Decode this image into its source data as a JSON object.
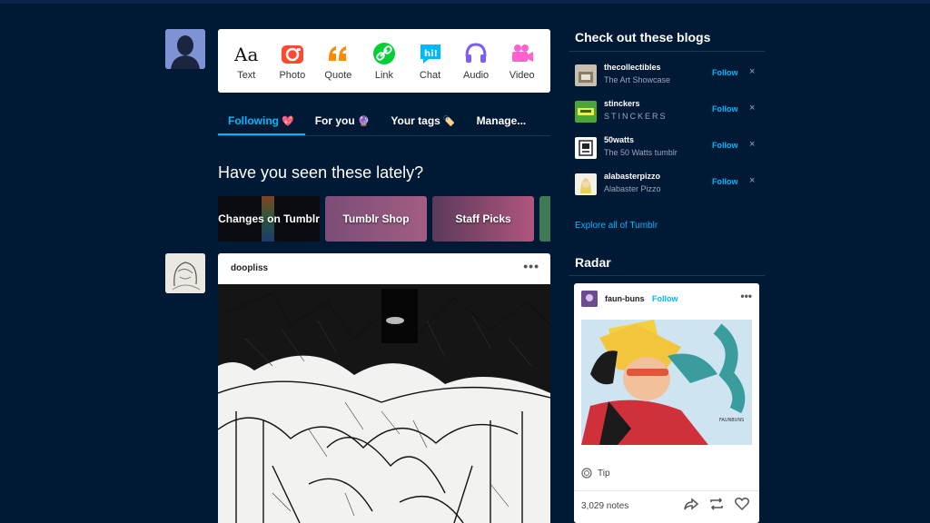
{
  "colors": {
    "background": "#001935",
    "accent": "#00b8ff",
    "card": "#ffffff"
  },
  "compose": {
    "items": [
      {
        "label": "Text",
        "icon": "text-icon"
      },
      {
        "label": "Photo",
        "icon": "camera-icon"
      },
      {
        "label": "Quote",
        "icon": "quote-icon"
      },
      {
        "label": "Link",
        "icon": "link-icon"
      },
      {
        "label": "Chat",
        "icon": "chat-icon"
      },
      {
        "label": "Audio",
        "icon": "headphones-icon"
      },
      {
        "label": "Video",
        "icon": "video-camera-icon"
      }
    ]
  },
  "tabs": [
    {
      "label": "Following",
      "emoji": "💖",
      "active": true
    },
    {
      "label": "For you",
      "emoji": "🔮",
      "active": false
    },
    {
      "label": "Your tags",
      "emoji": "🏷️",
      "active": false
    },
    {
      "label": "Manage...",
      "emoji": "",
      "active": false
    }
  ],
  "carousel": {
    "heading": "Have you seen these lately?",
    "cards": [
      "Changes on Tumblr",
      "Tumblr Shop",
      "Staff Picks"
    ]
  },
  "post": {
    "author": "doopliss",
    "menu": "•••"
  },
  "sidebar": {
    "heading": "Check out these blogs",
    "blogs": [
      {
        "name": "thecollectibles",
        "title": "The Art Showcase",
        "follow": "Follow",
        "dismiss": "×"
      },
      {
        "name": "stinckers",
        "title": "STINCKERS",
        "follow": "Follow",
        "dismiss": "×"
      },
      {
        "name": "50watts",
        "title": "The 50 Watts tumblr",
        "follow": "Follow",
        "dismiss": "×"
      },
      {
        "name": "alabasterpizzo",
        "title": "Alabaster Pizzo",
        "follow": "Follow",
        "dismiss": "×"
      }
    ],
    "explore": "Explore all of Tumblr"
  },
  "radar": {
    "heading": "Radar",
    "author": "faun-buns",
    "follow": "Follow",
    "menu": "•••",
    "art_signature": "FAUNBUNS",
    "tip": "Tip",
    "notes": "3,029 notes"
  }
}
